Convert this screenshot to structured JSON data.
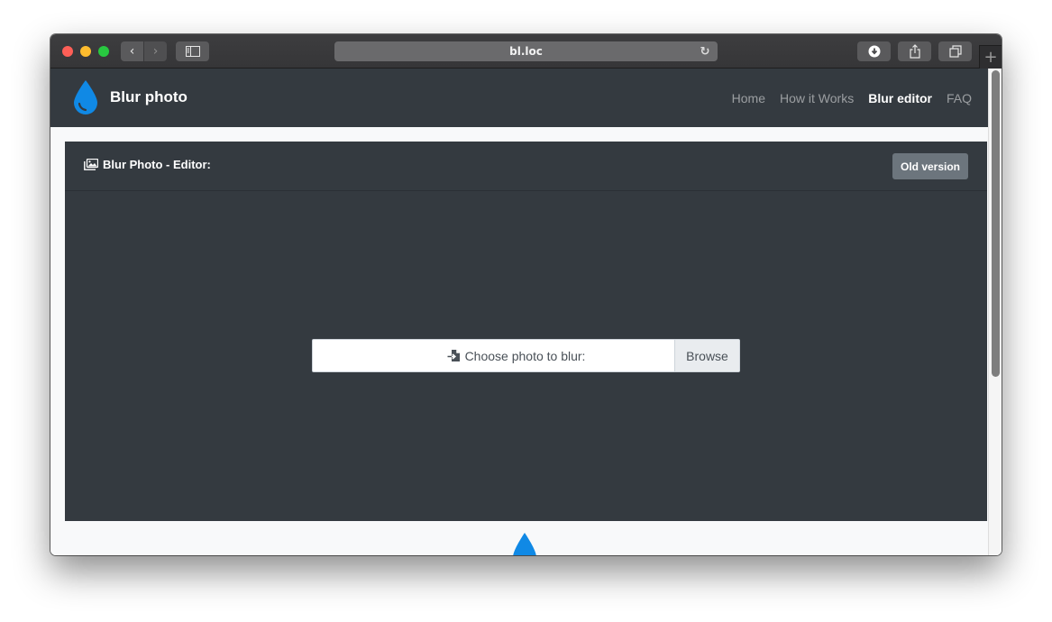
{
  "browser": {
    "url": "bl.loc",
    "back_glyph": "‹",
    "forward_glyph": "›",
    "new_tab_glyph": "+",
    "reload_glyph": "↻",
    "icons": {
      "back": "chevron-left-icon",
      "forward": "chevron-right-icon",
      "sidebar": "sidebar-icon",
      "reload": "reload-icon",
      "download": "download-icon",
      "share": "share-icon",
      "tabs": "tabs-overview-icon",
      "new_tab": "plus-icon"
    }
  },
  "navbar": {
    "brand": "Blur photo",
    "brand_color": "#1089e5",
    "links": [
      {
        "label": "Home",
        "active": false
      },
      {
        "label": "How it Works",
        "active": false
      },
      {
        "label": "Blur editor",
        "active": true
      },
      {
        "label": "FAQ",
        "active": false
      }
    ]
  },
  "editor": {
    "title": "Blur Photo - Editor:",
    "old_version_label": "Old version",
    "file_input": {
      "label": "Choose photo to blur:",
      "browse_label": "Browse"
    }
  },
  "colors": {
    "dark_bg": "#343a40",
    "secondary_btn": "#6c757d",
    "accent": "#1089e5"
  }
}
